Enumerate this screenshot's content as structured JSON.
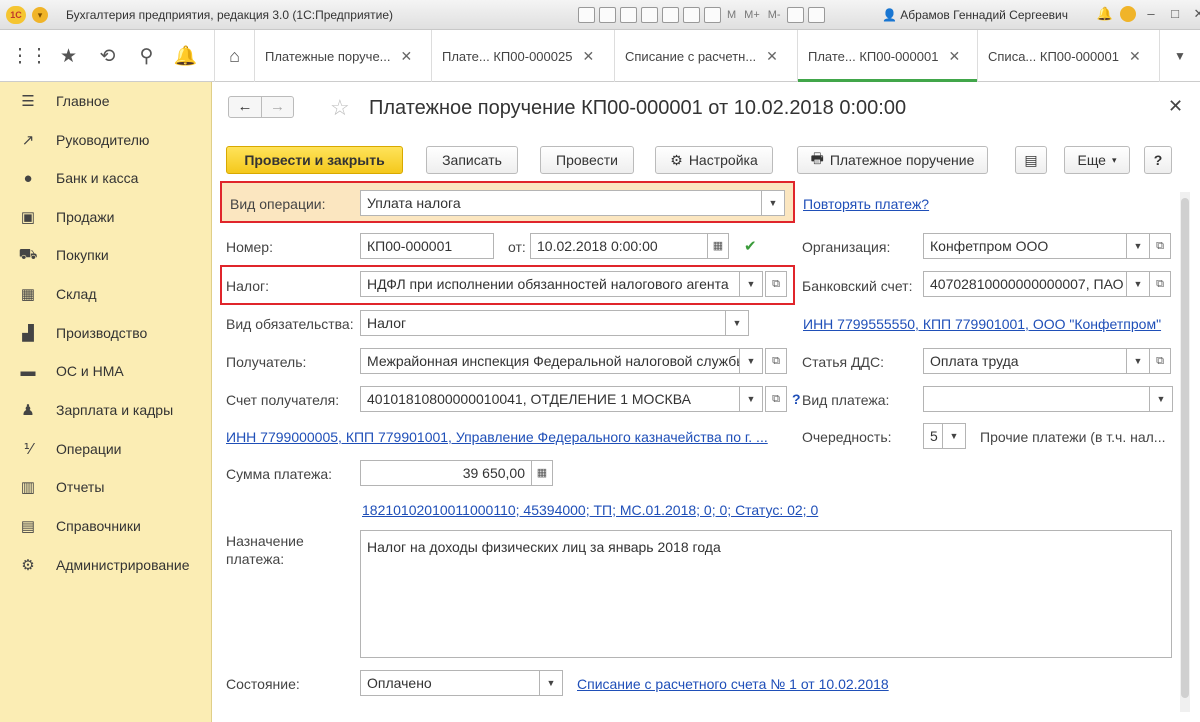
{
  "window": {
    "title": "Бухгалтерия предприятия, редакция 3.0 (1С:Предприятие)",
    "logo": "1С",
    "toolbar_texts": [
      "M",
      "M+",
      "M-"
    ],
    "user": "Абрамов Геннадий Сергеевич",
    "accent": "#f5c531"
  },
  "tabs": [
    {
      "label": "Платежные поруче...",
      "active": false
    },
    {
      "label": "Плате... КП00-000025",
      "active": false
    },
    {
      "label": "Списание с расчетн...",
      "active": false
    },
    {
      "label": "Плате... КП00-000001",
      "active": true
    },
    {
      "label": "Списа... КП00-000001",
      "active": false
    }
  ],
  "sidebar": {
    "items": [
      {
        "label": "Главное",
        "icon": "menu-lines-icon"
      },
      {
        "label": "Руководителю",
        "icon": "trend-icon"
      },
      {
        "label": "Банк и касса",
        "icon": "coin-icon"
      },
      {
        "label": "Продажи",
        "icon": "bag-icon"
      },
      {
        "label": "Покупки",
        "icon": "cart-icon"
      },
      {
        "label": "Склад",
        "icon": "warehouse-icon"
      },
      {
        "label": "Производство",
        "icon": "factory-icon"
      },
      {
        "label": "ОС и НМА",
        "icon": "truck-icon"
      },
      {
        "label": "Зарплата и кадры",
        "icon": "person-icon"
      },
      {
        "label": "Операции",
        "icon": "operations-icon"
      },
      {
        "label": "Отчеты",
        "icon": "bar-chart-icon"
      },
      {
        "label": "Справочники",
        "icon": "books-icon"
      },
      {
        "label": "Администрирование",
        "icon": "gear-icon"
      }
    ]
  },
  "document": {
    "title": "Платежное поручение КП00-000001 от 10.02.2018 0:00:00"
  },
  "commands": {
    "post_close": "Провести и закрыть",
    "save": "Записать",
    "post": "Провести",
    "settings": "Настройка",
    "print": "Платежное поручение",
    "more": "Еще",
    "help": "?"
  },
  "form": {
    "operation_label": "Вид операции:",
    "operation_value": "Уплата налога",
    "repeat_link": "Повторять платеж?",
    "number_label": "Номер:",
    "number_value": "КП00-000001",
    "date_label": "от:",
    "date_value": "10.02.2018  0:00:00",
    "org_label": "Организация:",
    "org_value": "Конфетпром ООО",
    "tax_label": "Налог:",
    "tax_value": "НДФЛ при исполнении обязанностей налогового агента",
    "bank_label": "Банковский счет:",
    "bank_value": "40702810000000000007, ПАО",
    "liability_label": "Вид обязательства:",
    "liability_value": "Налог",
    "org_inn_link": "ИНН 7799555550, КПП 779901001, ООО \"Конфетпром\"",
    "recipient_label": "Получатель:",
    "recipient_value": "Межрайонная инспекция Федеральной налоговой службы",
    "dds_label": "Статья ДДС:",
    "dds_value": "Оплата труда",
    "recipient_account_label": "Счет получателя:",
    "recipient_account_value": "40101810800000010041, ОТДЕЛЕНИЕ 1 МОСКВА",
    "question": "?",
    "payment_type_label": "Вид платежа:",
    "payment_type_value": "",
    "recipient_inn_link": "ИНН 7799000005, КПП 779901001, Управление Федерального казначейства по г. ...",
    "priority_label": "Очередность:",
    "priority_value": "5",
    "priority_desc": "Прочие платежи (в т.ч. нал...",
    "amount_label": "Сумма платежа:",
    "amount_value": "39 650,00",
    "budget_link": "18210102010011000110; 45394000; ТП; МС.01.2018; 0; 0; Статус: 02; 0",
    "purpose_label_1": "Назначение",
    "purpose_label_2": "платежа:",
    "purpose_value": "Налог на доходы физических лиц за январь 2018 года",
    "state_label": "Состояние:",
    "state_value": "Оплачено",
    "writeoff_link": "Списание с расчетного счета № 1 от 10.02.2018"
  }
}
